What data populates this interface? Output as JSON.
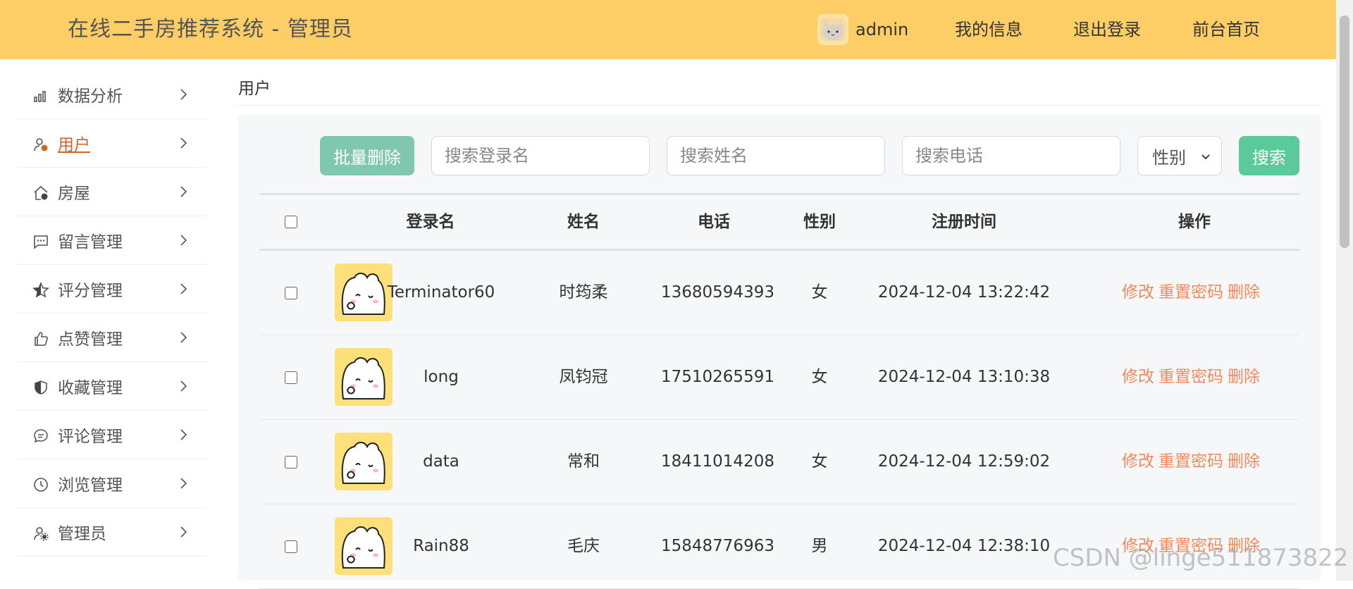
{
  "header": {
    "title": "在线二手房推荐系统 - 管理员",
    "username": "admin",
    "links": [
      "我的信息",
      "退出登录",
      "前台首页"
    ]
  },
  "sidebar": {
    "items": [
      {
        "label": "数据分析",
        "icon": "bar-chart-icon",
        "active": false
      },
      {
        "label": "用户",
        "icon": "user-icon",
        "active": true
      },
      {
        "label": "房屋",
        "icon": "house-icon",
        "active": false
      },
      {
        "label": "留言管理",
        "icon": "message-icon",
        "active": false
      },
      {
        "label": "评分管理",
        "icon": "star-icon",
        "active": false
      },
      {
        "label": "点赞管理",
        "icon": "thumbs-up-icon",
        "active": false
      },
      {
        "label": "收藏管理",
        "icon": "shield-heart-icon",
        "active": false
      },
      {
        "label": "评论管理",
        "icon": "comment-icon",
        "active": false
      },
      {
        "label": "浏览管理",
        "icon": "clock-icon",
        "active": false
      },
      {
        "label": "管理员",
        "icon": "admin-user-icon",
        "active": false
      }
    ]
  },
  "breadcrumb": "用户",
  "toolbar": {
    "batch_delete": "批量删除",
    "search_login_placeholder": "搜索登录名",
    "search_name_placeholder": "搜索姓名",
    "search_phone_placeholder": "搜索电话",
    "gender_select": "性别",
    "search_button": "搜索"
  },
  "table": {
    "headers": [
      "登录名",
      "姓名",
      "电话",
      "性别",
      "注册时间",
      "操作"
    ],
    "rows": [
      {
        "login": "Terminator60",
        "name": "时筠柔",
        "phone": "13680594393",
        "gender": "女",
        "time": "2024-12-04 13:22:42"
      },
      {
        "login": "long",
        "name": "凤钧冠",
        "phone": "17510265591",
        "gender": "女",
        "time": "2024-12-04 13:10:38"
      },
      {
        "login": "data",
        "name": "常和",
        "phone": "18411014208",
        "gender": "女",
        "time": "2024-12-04 12:59:02"
      },
      {
        "login": "Rain88",
        "name": "毛庆",
        "phone": "15848776963",
        "gender": "男",
        "time": "2024-12-04 12:38:10"
      }
    ],
    "actions": {
      "edit": "修改",
      "reset": "重置密码",
      "delete": "删除"
    }
  },
  "watermark": "CSDN @linge511873822",
  "colors": {
    "header_bg": "#fdce66",
    "active_menu": "#c8672b",
    "batch_button": "#80c7b0",
    "search_button": "#5cc99b",
    "action_link": "#f08a5d"
  }
}
